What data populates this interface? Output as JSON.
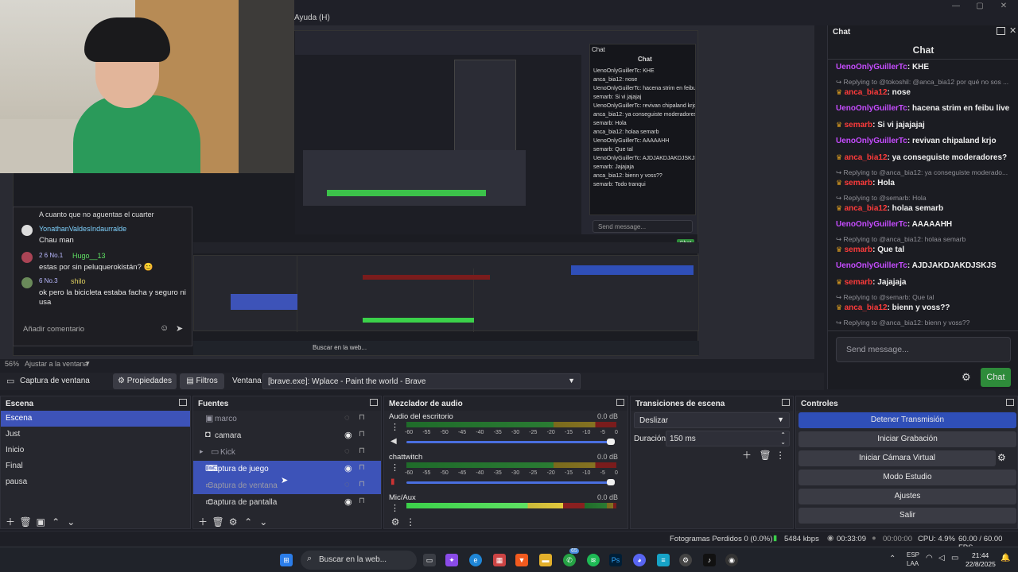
{
  "menu": {
    "help": "Ayuda (H)"
  },
  "preview": {
    "zoom": "56%",
    "fit_label": "Ajustar a la ventana",
    "mini_chat_title": "Chat",
    "mini_send": "Send message...",
    "mini_chat_btn": "Chat",
    "mini_search": "Buscar en la web...",
    "mini_lines": [
      "UenoOnlyGuillerTc: KHE",
      "anca_bia12: nose",
      "UenoOnlyGuillerTc: hacena strim en feibu live",
      "semarb: Si vi jajajaj",
      "UenoOnlyGuillerTc: revivan chipaland krjo",
      "anca_bia12: ya conseguiste moderadores?",
      "semarb: Hola",
      "anca_bia12: holaa semarb",
      "UenoOnlyGuillerTc: AAAAAHH",
      "semarb: Que tal",
      "UenoOnlyGuillerTc: AJDJAKDJAKDJSKJS",
      "semarb: Jajajaja",
      "anca_bia12: bienn y voss??",
      "semarb: Todo tranqui"
    ]
  },
  "overlay_chat": {
    "top_text": "A cuanto que no aguentas el cuarter",
    "messages": [
      {
        "user": "YonathanValdesIndaurralde",
        "badges": "",
        "text": "Chau man"
      },
      {
        "user": "Hugo__13",
        "badges": "2  6  No.1",
        "text": "estas por sin peluquerokistán? 😊"
      },
      {
        "user": "shilo",
        "badges": "6  No.3",
        "text": "ok pero la bicicleta estaba facha y seguro ni usa"
      }
    ],
    "placeholder": "Añadir comentario"
  },
  "properties_bar": {
    "source_name": "Captura de ventana",
    "properties": "Propiedades",
    "filters": "Filtros",
    "window_label": "Ventana",
    "window_value": "[brave.exe]: Wplace - Paint the world - Brave"
  },
  "scenes": {
    "title": "Escena",
    "items": [
      "Escena",
      "Just",
      "Inicio",
      "Final",
      "pausa"
    ],
    "selected": 0
  },
  "sources": {
    "title": "Fuentes",
    "items": [
      {
        "name": "marco",
        "icon": "image-icon",
        "visible": false,
        "locked": true,
        "selected": false,
        "dim": true
      },
      {
        "name": "camara",
        "icon": "camera-icon",
        "visible": true,
        "locked": true,
        "selected": false,
        "dim": false
      },
      {
        "name": "Kick",
        "icon": "folder-icon",
        "visible": false,
        "locked": true,
        "selected": false,
        "dim": true
      },
      {
        "name": "Captura de juego",
        "icon": "gamepad-icon",
        "visible": true,
        "locked": true,
        "selected": true,
        "dim": false
      },
      {
        "name": "Captura de ventana",
        "icon": "window-icon",
        "visible": false,
        "locked": true,
        "selected": true,
        "dim": true
      },
      {
        "name": "Captura de pantalla",
        "icon": "monitor-icon",
        "visible": true,
        "locked": true,
        "selected": false,
        "dim": false
      }
    ]
  },
  "mixer": {
    "title": "Mezclador de audio",
    "ticks": [
      "-60",
      "-55",
      "-50",
      "-45",
      "-40",
      "-35",
      "-30",
      "-25",
      "-20",
      "-15",
      "-10",
      "-5",
      "0"
    ],
    "channels": [
      {
        "name": "Audio del escritorio",
        "db": "0.0 dB",
        "level": 0.0,
        "muted": false
      },
      {
        "name": "chattwitch",
        "db": "0.0 dB",
        "level": 0.0,
        "muted": true
      },
      {
        "name": "Mic/Aux",
        "db": "0.0 dB",
        "level": 0.85,
        "muted": false
      }
    ]
  },
  "transitions": {
    "title": "Transiciones de escena",
    "type": "Deslizar",
    "duration_label": "Duración",
    "duration_value": "150 ms"
  },
  "controls": {
    "title": "Controles",
    "buttons": [
      "Detener Transmisión",
      "Iniciar Grabación",
      "Iniciar Cámara Virtual",
      "Modo Estudio",
      "Ajustes",
      "Salir"
    ]
  },
  "chat": {
    "window_title": "Chat",
    "header": "Chat",
    "send_placeholder": "Send message...",
    "send_button": "Chat",
    "messages": [
      {
        "reply": "",
        "user": "UenoOnlyGuillerTc",
        "color": "#c64cff",
        "crown": false,
        "text": ": KHE"
      },
      {
        "reply": "Replying to @tokoshil: @anca_bia12 por qué no sos ...",
        "user": "anca_bia12",
        "color": "#ff3b3b",
        "crown": true,
        "text": ": nose"
      },
      {
        "reply": "",
        "user": "UenoOnlyGuillerTc",
        "color": "#c64cff",
        "crown": false,
        "text": ": hacena strim en feibu live"
      },
      {
        "reply": "",
        "user": "semarb",
        "color": "#ff3b3b",
        "crown": true,
        "text": ": Si vi jajajajaj"
      },
      {
        "reply": "",
        "user": "UenoOnlyGuillerTc",
        "color": "#c64cff",
        "crown": false,
        "text": ": revivan chipaland krjo"
      },
      {
        "reply": "",
        "user": "anca_bia12",
        "color": "#ff3b3b",
        "crown": true,
        "text": ": ya conseguiste moderadores?"
      },
      {
        "reply": "Replying to @anca_bia12: ya conseguiste moderado...",
        "user": "semarb",
        "color": "#ff3b3b",
        "crown": true,
        "text": ": Hola"
      },
      {
        "reply": "Replying to @semarb: Hola",
        "user": "anca_bia12",
        "color": "#ff3b3b",
        "crown": true,
        "text": ": holaa semarb"
      },
      {
        "reply": "",
        "user": "UenoOnlyGuillerTc",
        "color": "#c64cff",
        "crown": false,
        "text": ": AAAAAHH"
      },
      {
        "reply": "Replying to @anca_bia12: holaa semarb",
        "user": "semarb",
        "color": "#ff3b3b",
        "crown": true,
        "text": ": Que tal"
      },
      {
        "reply": "",
        "user": "UenoOnlyGuillerTc",
        "color": "#c64cff",
        "crown": false,
        "text": ": AJDJAKDJAKDJSKJS"
      },
      {
        "reply": "",
        "user": "semarb",
        "color": "#ff3b3b",
        "crown": true,
        "text": ": Jajajaja"
      },
      {
        "reply": "Replying to @semarb: Que tal",
        "user": "anca_bia12",
        "color": "#ff3b3b",
        "crown": true,
        "text": ": bienn y voss??"
      },
      {
        "reply": "Replying to @anca_bia12: bienn y voss??",
        "user": "semarb",
        "color": "#ff3b3b",
        "crown": true,
        "text": ": Todo tranqui"
      }
    ]
  },
  "status": {
    "dropped": "Fotogramas Perdidos 0 (0.0%)",
    "bitrate": "5484 kbps",
    "stream_time": "00:33:09",
    "rec_time": "00:00:00",
    "cpu": "CPU: 4.9%",
    "fps": "60.00 / 60.00 FPS"
  },
  "taskbar": {
    "search": "Buscar en la web...",
    "lang_top": "ESP",
    "lang_bottom": "LAA",
    "time": "21:44",
    "date": "22/8/2025",
    "badge": "65"
  },
  "colors": {
    "accent": "#3d53b8",
    "chat_green": "#2e8b3a",
    "gold": "#e0a020"
  }
}
